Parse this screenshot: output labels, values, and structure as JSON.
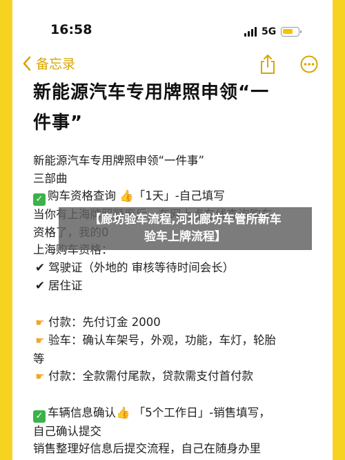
{
  "status_bar": {
    "time": "16:58",
    "network": "5G"
  },
  "nav": {
    "back_label": "备忘录"
  },
  "note": {
    "title_line1": "新能源汽车专用牌照申领“一",
    "title_line2": "件事”",
    "lines": [
      {
        "kind": "text",
        "text": "新能源汽车专用牌照申领“一件事”"
      },
      {
        "kind": "text",
        "text": "三部曲"
      },
      {
        "kind": "check",
        "text": "购车资格查询 👍「1天」-自己填写"
      },
      {
        "kind": "text",
        "text": "当你有上海牌照额度后，在网上点在线查询购车"
      },
      {
        "kind": "text",
        "text": "资格了，我的0"
      },
      {
        "kind": "text",
        "text": "上海购车资格："
      },
      {
        "kind": "tick",
        "text": "驾驶证（外地的 审核等待时间会长）"
      },
      {
        "kind": "tick",
        "text": "居住证"
      },
      {
        "kind": "gap",
        "text": ""
      },
      {
        "kind": "hand",
        "text": "付款：先付订金 2000"
      },
      {
        "kind": "hand",
        "text": "验车：确认车架号，外观，功能，车灯，轮胎"
      },
      {
        "kind": "text",
        "text": "等"
      },
      {
        "kind": "hand",
        "text": "付款：全款需付尾款，贷款需支付首付款"
      },
      {
        "kind": "gap",
        "text": ""
      },
      {
        "kind": "check",
        "text": "车辆信息确认👍 「5个工作日」-销售填写，"
      },
      {
        "kind": "text",
        "text": "自己确认提交"
      },
      {
        "kind": "text",
        "text": "销售整理好信息后提交流程，自己在随身办里"
      }
    ]
  },
  "overlay": {
    "line1": "【廊坊验车流程,河北廊坊车管所新车",
    "line2": "验车上牌流程】"
  },
  "colors": {
    "page_background": "#f7d321",
    "accent": "#d9a500",
    "check": "#3bb34a",
    "overlay": "#5f5f5f"
  },
  "icons": {
    "back": "chevron-left-icon",
    "share": "share-icon",
    "more": "more-icon",
    "check": "check-box-icon",
    "hand": "pointing-hand-icon",
    "tick": "check-mark-icon"
  }
}
